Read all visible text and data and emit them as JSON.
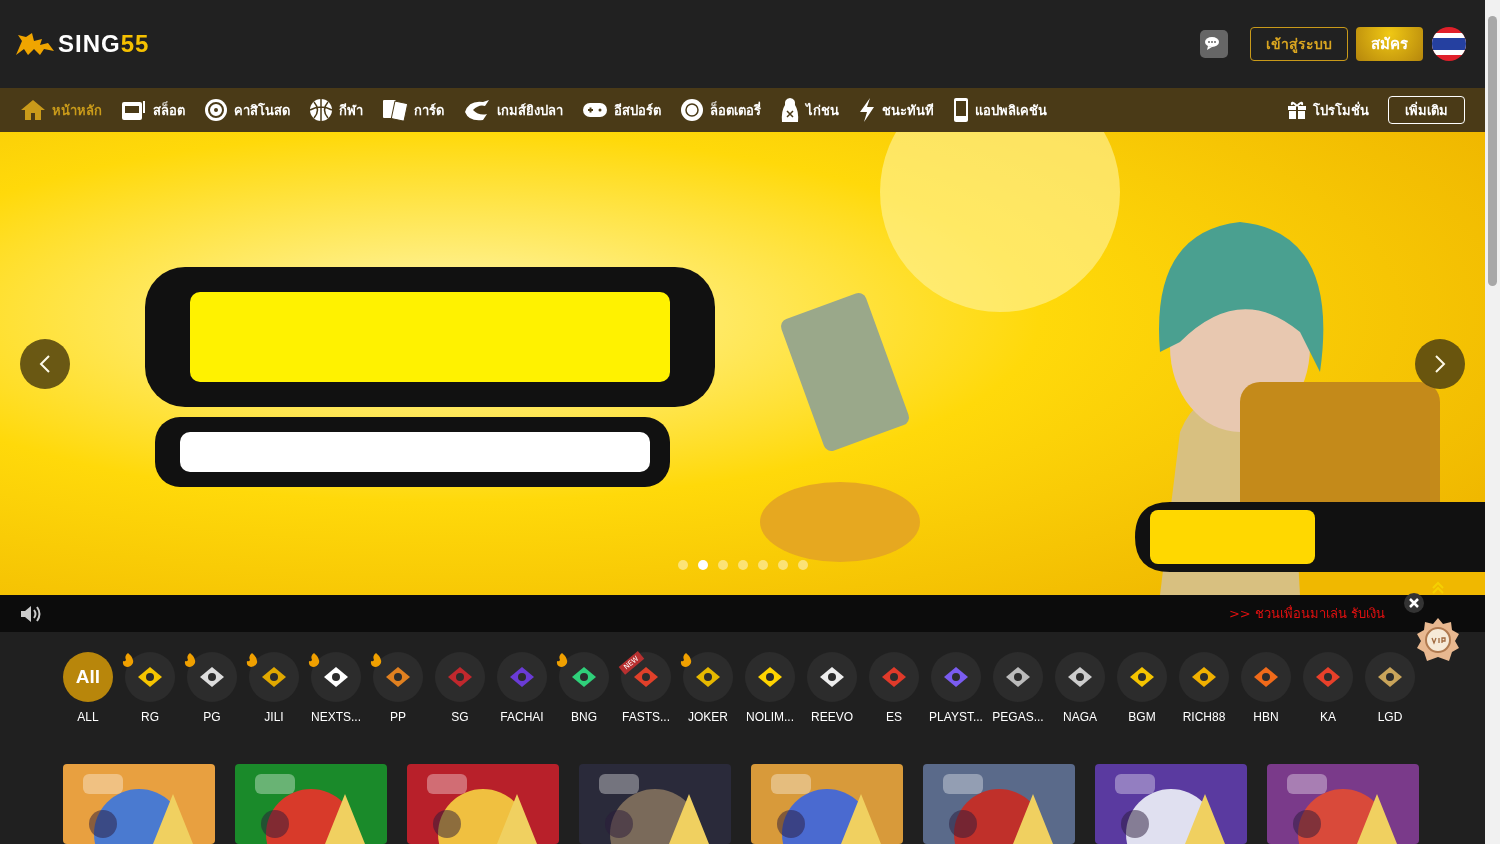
{
  "logo": {
    "text": "SING",
    "accent": "55"
  },
  "header": {
    "login": "เข้าสู่ระบบ",
    "register": "สมัคร"
  },
  "nav": [
    {
      "label": "หน้าหลัก",
      "selected": true
    },
    {
      "label": "สล็อต",
      "selected": false
    },
    {
      "label": "คาสิโนสด",
      "selected": false
    },
    {
      "label": "กีฬา",
      "selected": false
    },
    {
      "label": "การ์ด",
      "selected": false
    },
    {
      "label": "เกมส์ยิงปลา",
      "selected": false
    },
    {
      "label": "อีสปอร์ต",
      "selected": false
    },
    {
      "label": "ล็อตเตอรี่",
      "selected": false
    },
    {
      "label": "ไก่ชน",
      "selected": false
    },
    {
      "label": "ชนะทันที",
      "selected": false
    },
    {
      "label": "แอปพลิเคชัน",
      "selected": false
    }
  ],
  "promo": "โปรโมชั่น",
  "more": "เพิ่มเติม",
  "banner": {
    "dots": [
      {
        "selected": false
      },
      {
        "selected": true
      },
      {
        "selected": false
      },
      {
        "selected": false
      },
      {
        "selected": false
      },
      {
        "selected": false
      },
      {
        "selected": false
      }
    ]
  },
  "ticker": ">> ชวนเพื่อนมาเล่น รับเงิน",
  "providers": [
    {
      "label": "ALL",
      "badge": "All",
      "selected": true,
      "hot": false
    },
    {
      "label": "RG",
      "selected": false,
      "hot": true
    },
    {
      "label": "PG",
      "selected": false,
      "hot": true
    },
    {
      "label": "JILI",
      "selected": false,
      "hot": true
    },
    {
      "label": "NEXTS...",
      "selected": false,
      "hot": true
    },
    {
      "label": "PP",
      "selected": false,
      "hot": true
    },
    {
      "label": "SG",
      "selected": false,
      "hot": false
    },
    {
      "label": "FACHAI",
      "selected": false,
      "hot": false
    },
    {
      "label": "BNG",
      "selected": false,
      "hot": true
    },
    {
      "label": "FASTS...",
      "selected": false,
      "hot": false,
      "tag": "NEW"
    },
    {
      "label": "JOKER",
      "selected": false,
      "hot": true
    },
    {
      "label": "NOLIM...",
      "selected": false,
      "hot": false
    },
    {
      "label": "REEVO",
      "selected": false,
      "hot": false
    },
    {
      "label": "ES",
      "selected": false,
      "hot": false
    },
    {
      "label": "PLAYST...",
      "selected": false,
      "hot": false
    },
    {
      "label": "PEGAS...",
      "selected": false,
      "hot": false
    },
    {
      "label": "NAGA",
      "selected": false,
      "hot": false
    },
    {
      "label": "BGM",
      "selected": false,
      "hot": false
    },
    {
      "label": "RICH88",
      "selected": false,
      "hot": false
    },
    {
      "label": "HBN",
      "selected": false,
      "hot": false
    },
    {
      "label": "KA",
      "selected": false,
      "hot": false
    },
    {
      "label": "LGD",
      "selected": false,
      "hot": false
    }
  ]
}
